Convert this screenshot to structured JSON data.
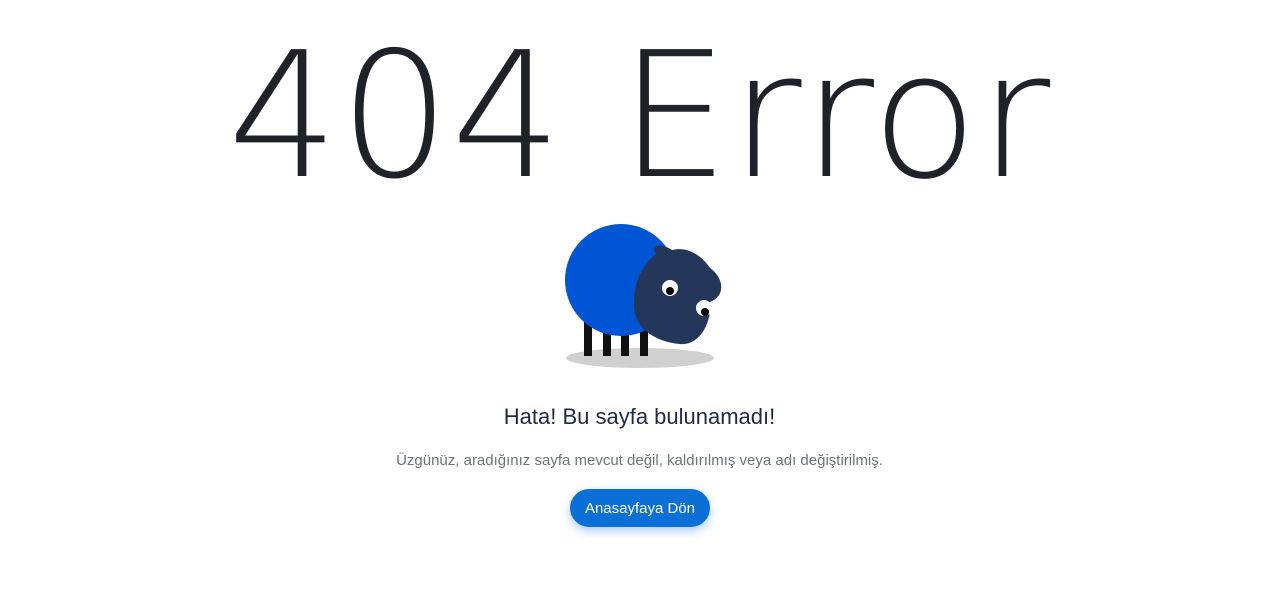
{
  "error": {
    "title": "404 Error"
  },
  "illustration": {
    "name": "sheep-icon",
    "body_color": "#0055d4",
    "head_color": "#243659",
    "shadow_color": "#d0d0d0"
  },
  "message": {
    "heading": "Hata! Bu sayfa bulunamadı!",
    "description": "Üzgünüz, aradığınız sayfa mevcut değil, kaldırılmış veya adı değiştirilmiş."
  },
  "actions": {
    "home_label": "Anasayfaya Dön",
    "button_color": "#0b6fd8"
  }
}
